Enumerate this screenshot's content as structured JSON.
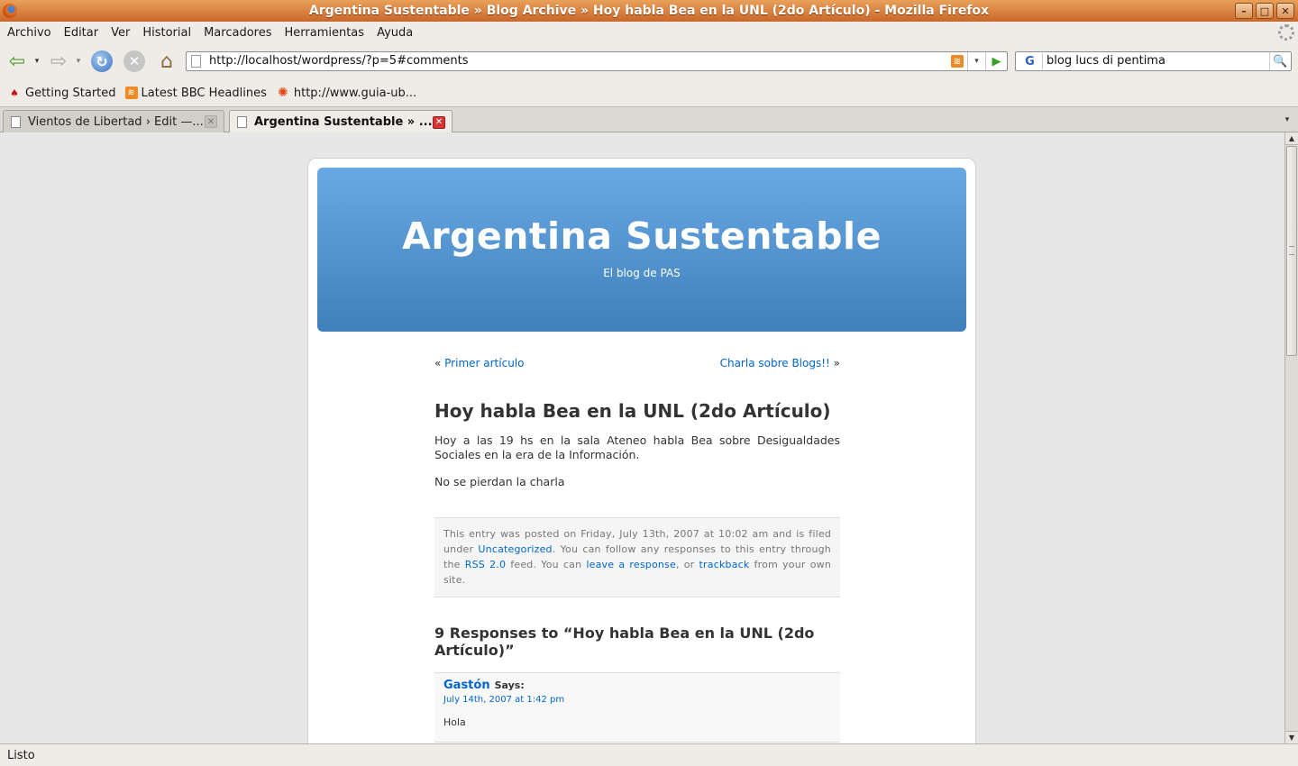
{
  "window": {
    "title": "Argentina Sustentable » Blog Archive » Hoy habla Bea en la UNL (2do Artículo) - Mozilla Firefox",
    "minimize_glyph": "–",
    "maximize_glyph": "□",
    "close_glyph": "✕"
  },
  "menu": {
    "items": [
      "Archivo",
      "Editar",
      "Ver",
      "Historial",
      "Marcadores",
      "Herramientas",
      "Ayuda"
    ]
  },
  "toolbar": {
    "back_glyph": "⇦",
    "forward_glyph": "⇨",
    "dropdown_glyph": "▾",
    "reload_glyph": "↻",
    "stop_glyph": "✕",
    "home_glyph": "⌂",
    "url": "http://localhost/wordpress/?p=5#comments",
    "rss_glyph": "≋",
    "go_glyph": "▶",
    "search_engine_glyph": "G",
    "search_text": "blog lucs di pentima",
    "search_glyph": "🔍"
  },
  "bookmarks": {
    "items": [
      {
        "label": "Getting Started",
        "icon": "redhat-icon",
        "glyph": "♠"
      },
      {
        "label": "Latest BBC Headlines",
        "icon": "rss-icon",
        "glyph": "≋"
      },
      {
        "label": "http://www.guia-ub...",
        "icon": "ubuntu-icon",
        "glyph": "✺"
      }
    ]
  },
  "tabs": [
    {
      "label": "Vientos de Libertad › Edit —...",
      "active": false
    },
    {
      "label": "Argentina Sustentable » ...",
      "active": true
    }
  ],
  "tab_close_glyph": "✕",
  "tab_list_glyph": "▾",
  "scrollbar": {
    "up_glyph": "▲",
    "down_glyph": "▼"
  },
  "blog": {
    "title": "Argentina Sustentable",
    "description": "El blog de PAS"
  },
  "post_nav": {
    "prev_quote": "« ",
    "prev_label": "Primer artículo",
    "next_label": "Charla sobre Blogs!!",
    "next_quote": " »"
  },
  "post": {
    "title": "Hoy habla Bea en la UNL (2do Artículo)",
    "paragraphs": [
      "Hoy a las 19 hs en la sala Ateneo habla Bea sobre Desigualdades Sociales en la era de la Información.",
      "No se pierdan la charla"
    ],
    "meta": {
      "text_1": "This entry was posted on Friday, July 13th, 2007 at 10:02 am and is filed under ",
      "category": "Uncategorized",
      "text_2": ". You can follow any responses to this entry through the ",
      "rss": "RSS 2.0",
      "text_3": " feed. You can ",
      "leave_response": "leave a response",
      "text_4": ", or ",
      "trackback": "trackback",
      "text_5": " from your own site."
    }
  },
  "comments": {
    "heading": "9 Responses to “Hoy habla Bea en la UNL (2do Artículo)”",
    "items": [
      {
        "author": "Gastón",
        "says": "Says:",
        "date": "July 14th, 2007 at 1:42 pm",
        "text": "Hola"
      }
    ]
  },
  "status": {
    "text": "Listo"
  },
  "colors": {
    "header_top": "#69a8e4",
    "header_bottom": "#3f80bb",
    "link": "#0066cc",
    "titlebar": "#d07a3a"
  }
}
